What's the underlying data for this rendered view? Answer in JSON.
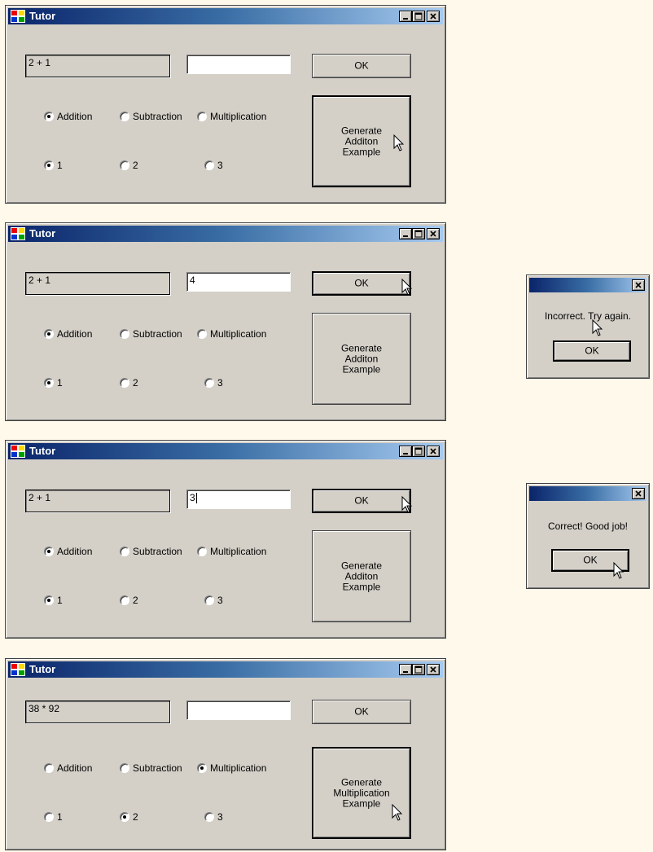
{
  "app_title": "Tutor",
  "window_controls": [
    "minimize-icon",
    "maximize-icon",
    "close-icon"
  ],
  "windows": [
    {
      "problem": "2 + 1",
      "answer": "",
      "ok_label": "OK",
      "operations": [
        "Addition",
        "Subtraction",
        "Multiplication"
      ],
      "selected_operation": "Addition",
      "levels": [
        "1",
        "2",
        "3"
      ],
      "selected_level": "1",
      "generate_label": [
        "Generate",
        "Additon",
        "Example"
      ]
    },
    {
      "problem": "2 + 1",
      "answer": "4",
      "ok_label": "OK",
      "operations": [
        "Addition",
        "Subtraction",
        "Multiplication"
      ],
      "selected_operation": "Addition",
      "levels": [
        "1",
        "2",
        "3"
      ],
      "selected_level": "1",
      "generate_label": [
        "Generate",
        "Additon",
        "Example"
      ]
    },
    {
      "problem": "2 + 1",
      "answer": "3",
      "ok_label": "OK",
      "operations": [
        "Addition",
        "Subtraction",
        "Multiplication"
      ],
      "selected_operation": "Addition",
      "levels": [
        "1",
        "2",
        "3"
      ],
      "selected_level": "1",
      "generate_label": [
        "Generate",
        "Additon",
        "Example"
      ]
    },
    {
      "problem": "38 * 92",
      "answer": "",
      "ok_label": "OK",
      "operations": [
        "Addition",
        "Subtraction",
        "Multiplication"
      ],
      "selected_operation": "Multiplication",
      "levels": [
        "1",
        "2",
        "3"
      ],
      "selected_level": "2",
      "generate_label": [
        "Generate",
        "Multiplication",
        "Example"
      ]
    }
  ],
  "message_boxes": [
    {
      "message": "Incorrect. Try again.",
      "ok_label": "OK"
    },
    {
      "message": "Correct!  Good job!",
      "ok_label": "OK"
    }
  ],
  "colors": {
    "page_background": "#fef9ea",
    "window_face": "#d4d0c8",
    "title_gradient_start": "#0a246a",
    "title_gradient_end": "#a6caf0"
  }
}
